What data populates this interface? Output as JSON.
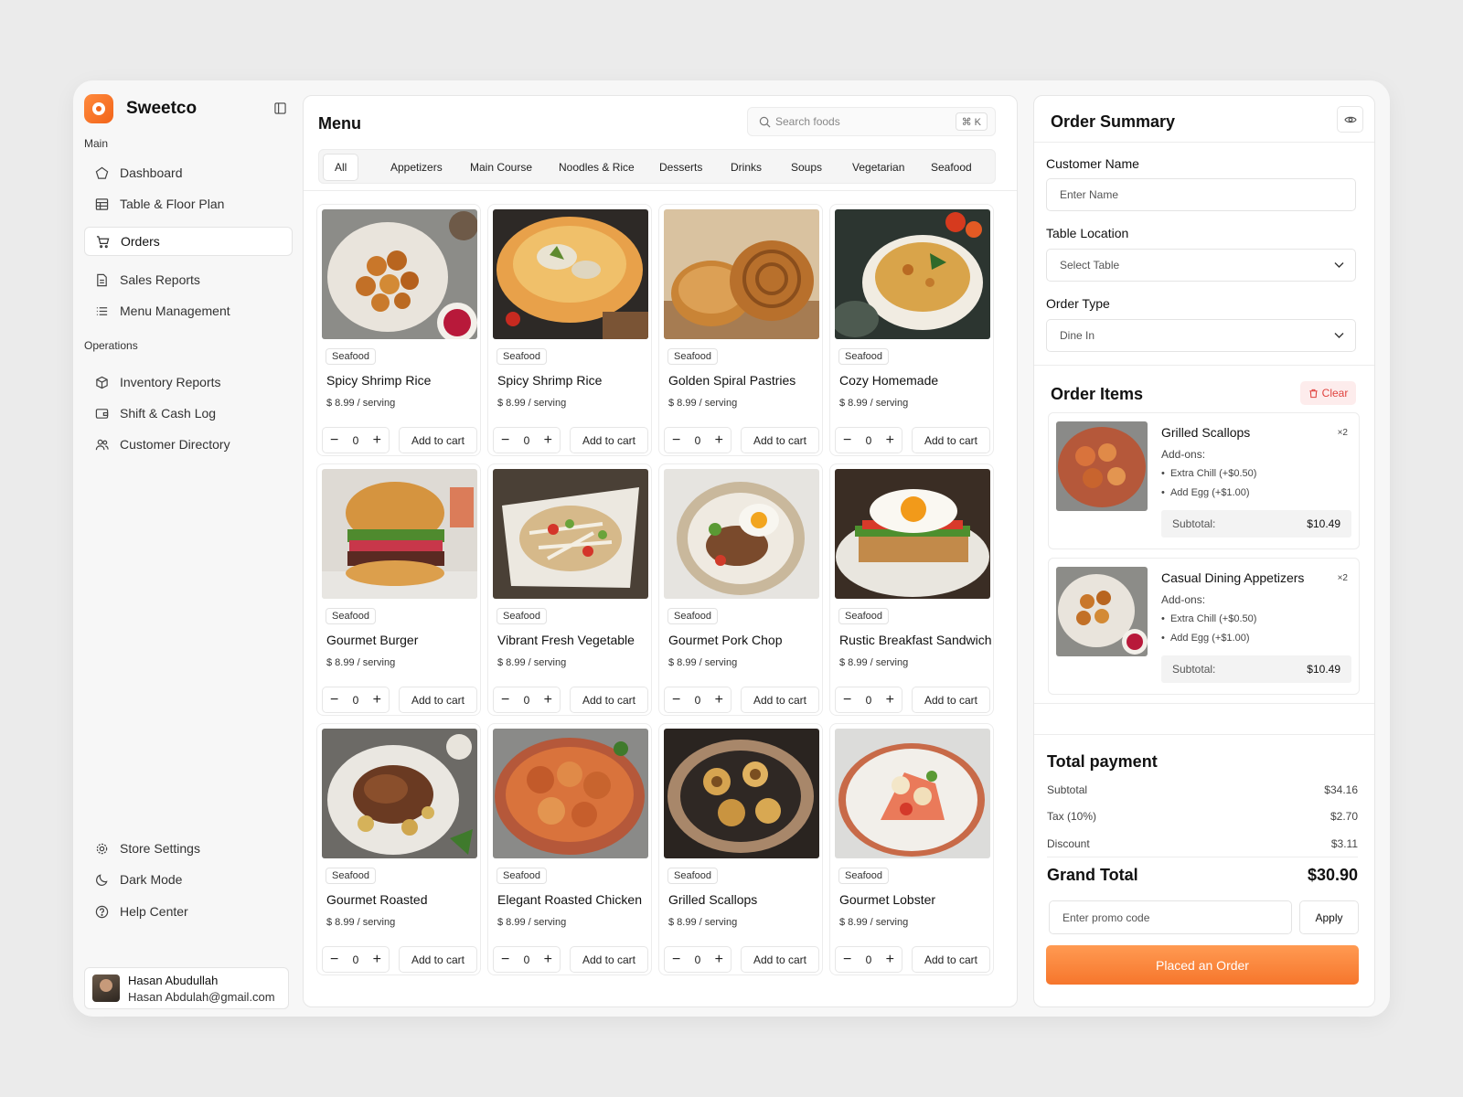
{
  "brand": {
    "name": "Sweetco"
  },
  "sidebar": {
    "main_label": "Main",
    "main_items": [
      {
        "label": "Dashboard",
        "icon": "pentagon-icon"
      },
      {
        "label": "Table & Floor Plan",
        "icon": "table-grid-icon"
      },
      {
        "label": "Orders",
        "icon": "cart-icon",
        "active": true
      },
      {
        "label": "Sales Reports",
        "icon": "report-icon"
      },
      {
        "label": "Menu Management",
        "icon": "list-icon"
      }
    ],
    "operations_label": "Operations",
    "operations_items": [
      {
        "label": "Inventory Reports",
        "icon": "box-icon"
      },
      {
        "label": "Shift & Cash Log",
        "icon": "wallet-icon"
      },
      {
        "label": "Customer Directory",
        "icon": "users-icon"
      }
    ],
    "bottom_items": [
      {
        "label": "Store Settings",
        "icon": "gear-icon"
      },
      {
        "label": "Dark Mode",
        "icon": "moon-icon"
      },
      {
        "label": "Help Center",
        "icon": "help-icon"
      }
    ],
    "user": {
      "name": "Hasan Abudullah",
      "email": "Hasan Abdulah@gmail.com"
    }
  },
  "menu": {
    "title": "Menu",
    "search_placeholder": "Search foods",
    "search_shortcut": "⌘  K",
    "categories": [
      "All",
      "Appetizers",
      "Main Course",
      "Noodles & Rice",
      "Desserts",
      "Drinks",
      "Soups",
      "Vegetarian",
      "Seafood"
    ],
    "active_category": "All",
    "add_to_cart_label": "Add to cart",
    "items": [
      {
        "tag": "Seafood",
        "name": "Spicy Shrimp Rice",
        "price": "$ 8.99 / serving",
        "qty": "0"
      },
      {
        "tag": "Seafood",
        "name": "Spicy Shrimp Rice",
        "price": "$ 8.99 / serving",
        "qty": "0"
      },
      {
        "tag": "Seafood",
        "name": "Golden Spiral Pastries",
        "price": "$ 8.99 / serving",
        "qty": "0"
      },
      {
        "tag": "Seafood",
        "name": "Cozy Homemade",
        "price": "$ 8.99 / serving",
        "qty": "0"
      },
      {
        "tag": "Seafood",
        "name": "Gourmet Burger",
        "price": "$ 8.99 / serving",
        "qty": "0"
      },
      {
        "tag": "Seafood",
        "name": "Vibrant Fresh Vegetable",
        "price": "$ 8.99 / serving",
        "qty": "0"
      },
      {
        "tag": "Seafood",
        "name": "Gourmet Pork Chop",
        "price": "$ 8.99 / serving",
        "qty": "0"
      },
      {
        "tag": "Seafood",
        "name": "Rustic Breakfast Sandwich",
        "price": "$ 8.99 / serving",
        "qty": "0"
      },
      {
        "tag": "Seafood",
        "name": "Gourmet Roasted",
        "price": "$ 8.99 / serving",
        "qty": "0"
      },
      {
        "tag": "Seafood",
        "name": "Elegant Roasted Chicken",
        "price": "$ 8.99 / serving",
        "qty": "0"
      },
      {
        "tag": "Seafood",
        "name": "Grilled Scallops",
        "price": "$ 8.99 / serving",
        "qty": "0"
      },
      {
        "tag": "Seafood",
        "name": "Gourmet Lobster",
        "price": "$ 8.99 / serving",
        "qty": "0"
      }
    ]
  },
  "order": {
    "title": "Order Summary",
    "customer_label": "Customer Name",
    "customer_placeholder": "Enter Name",
    "table_label": "Table Location",
    "table_value": "Select Table",
    "type_label": "Order Type",
    "type_value": "Dine In",
    "items_title": "Order Items",
    "clear_label": "Clear",
    "addons_label": "Add-ons:",
    "subtotal_label": "Subtotal:",
    "items": [
      {
        "name": "Grilled Scallops",
        "qty": "×2",
        "addons": [
          "Extra Chill (+$0.50)",
          "Add Egg (+$1.00)"
        ],
        "subtotal": "$10.49"
      },
      {
        "name": "Casual Dining Appetizers",
        "qty": "×2",
        "addons": [
          "Extra Chill (+$0.50)",
          "Add Egg (+$1.00)"
        ],
        "subtotal": "$10.49"
      }
    ],
    "total_title": "Total payment",
    "totals": [
      {
        "label": "Subtotal",
        "value": "$34.16"
      },
      {
        "label": "Tax (10%)",
        "value": "$2.70"
      },
      {
        "label": "Discount",
        "value": "$3.11"
      }
    ],
    "grand_total_label": "Grand Total",
    "grand_total_value": "$30.90",
    "promo_placeholder": "Enter promo code",
    "apply_label": "Apply",
    "place_label": "Placed an Order"
  },
  "colors": {
    "accent": "#f6762c",
    "danger": "#e0433f"
  }
}
